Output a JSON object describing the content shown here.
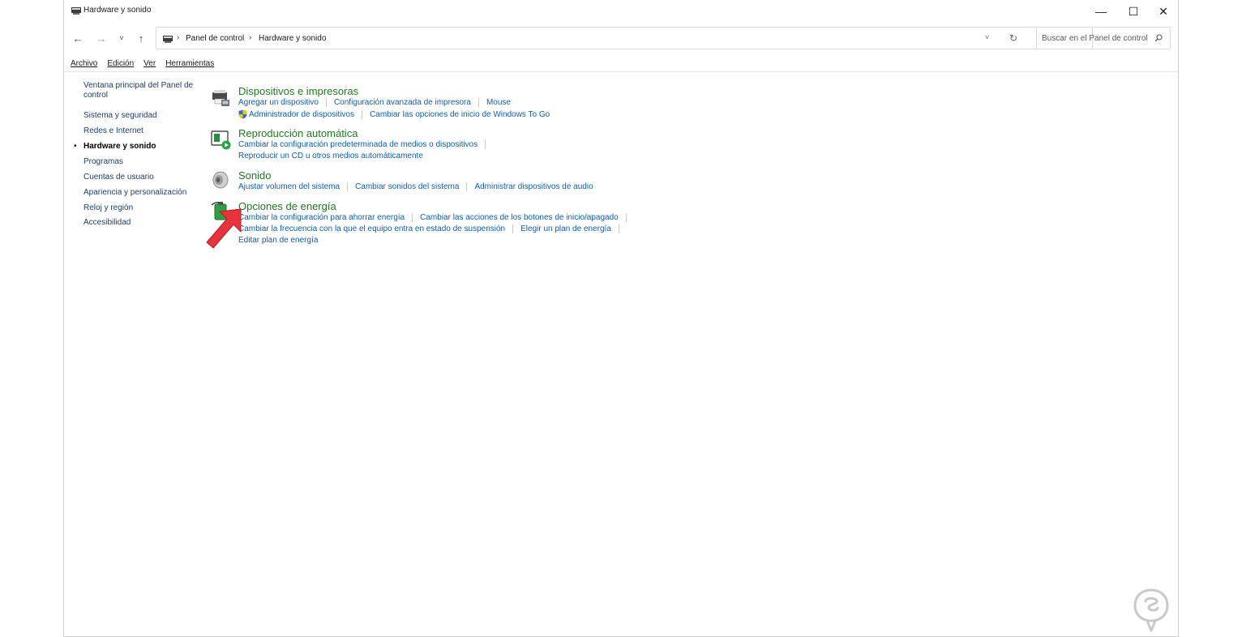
{
  "window": {
    "title": "Hardware y sonido",
    "controls": {
      "minimize": "—",
      "maximize": "☐",
      "close": "✕"
    }
  },
  "nav": {
    "back": "←",
    "forward": "→",
    "recent": "˅",
    "up": "↑",
    "breadcrumb": [
      "Panel de control",
      "Hardware y sonido"
    ],
    "breadcrumb_sep": "›",
    "dropdown": "˅",
    "refresh": "↻",
    "search_placeholder": "Buscar en el Panel de control"
  },
  "menu": [
    "Archivo",
    "Edición",
    "Ver",
    "Herramientas"
  ],
  "sidebar": {
    "main_link": "Ventana principal del Panel de control",
    "items": [
      {
        "label": "Sistema y seguridad",
        "current": false
      },
      {
        "label": "Redes e Internet",
        "current": false
      },
      {
        "label": "Hardware y sonido",
        "current": true
      },
      {
        "label": "Programas",
        "current": false
      },
      {
        "label": "Cuentas de usuario",
        "current": false
      },
      {
        "label": "Apariencia y personalización",
        "current": false
      },
      {
        "label": "Reloj y región",
        "current": false
      },
      {
        "label": "Accesibilidad",
        "current": false
      }
    ],
    "bullet": "•"
  },
  "sections": [
    {
      "title": "Dispositivos e impresoras",
      "icon": "devices-printers-icon",
      "rows": [
        [
          "Agregar un dispositivo",
          "Configuración avanzada de impresora",
          "Mouse"
        ],
        [
          "Administrador de dispositivos",
          "Cambiar las opciones de inicio de Windows To Go"
        ]
      ]
    },
    {
      "title": "Reproducción automática",
      "icon": "autoplay-icon",
      "rows": [
        [
          "Cambiar la configuración predeterminada de medios o dispositivos"
        ],
        [
          "Reproducir un CD u otros medios automáticamente"
        ]
      ]
    },
    {
      "title": "Sonido",
      "icon": "speaker-icon",
      "rows": [
        [
          "Ajustar volumen del sistema",
          "Cambiar sonidos del sistema",
          "Administrar dispositivos de audio"
        ]
      ]
    },
    {
      "title": "Opciones de energía",
      "icon": "battery-power-icon",
      "rows": [
        [
          "Cambiar la configuración para ahorrar energía",
          "Cambiar las acciones de los botones de inicio/apagado"
        ],
        [
          "Cambiar la frecuencia con la que el equipo entra en estado de suspensión",
          "Elegir un plan de energía"
        ],
        [
          "Editar plan de energía"
        ]
      ]
    }
  ],
  "colors": {
    "section_title": "#1e7c1e",
    "link": "#0b5fb8",
    "annotation_arrow": "#e8323c"
  }
}
